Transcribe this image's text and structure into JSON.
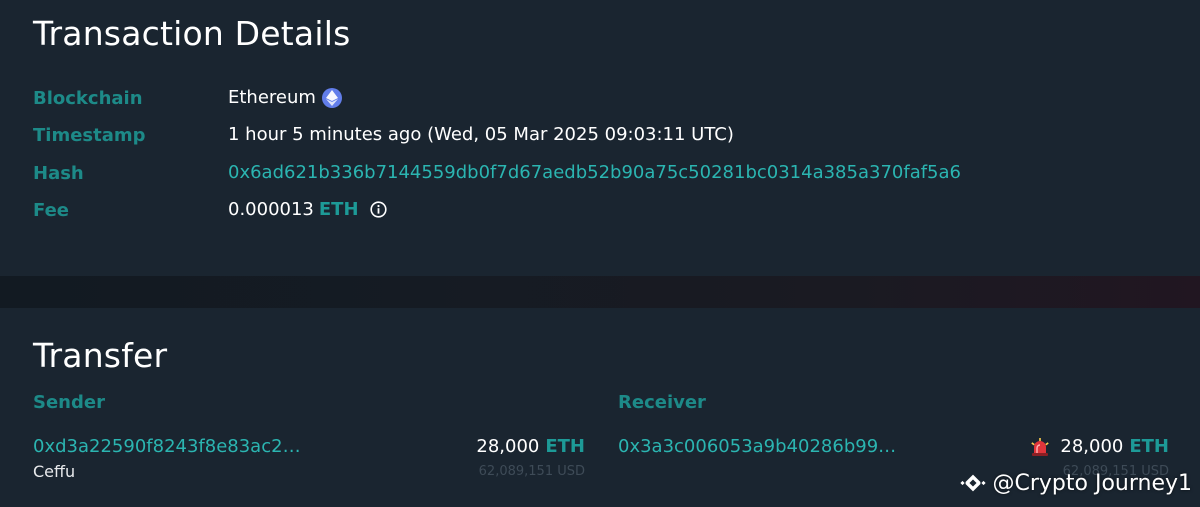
{
  "details": {
    "title": "Transaction Details",
    "rows": {
      "blockchain": {
        "label": "Blockchain",
        "value": "Ethereum",
        "icon": "ethereum-icon"
      },
      "timestamp": {
        "label": "Timestamp",
        "value": "1 hour 5 minutes ago (Wed, 05 Mar 2025 09:03:11 UTC)"
      },
      "hash": {
        "label": "Hash",
        "value": "0x6ad621b336b7144559db0f7d67aedb52b90a75c50281bc0314a385a370faf5a6"
      },
      "fee": {
        "label": "Fee",
        "amount": "0.000013",
        "unit": "ETH",
        "icon": "info-icon"
      }
    }
  },
  "transfer": {
    "title": "Transfer",
    "sender": {
      "label": "Sender",
      "address": "0xd3a22590f8243f8e83ac2…",
      "entity": "Ceffu",
      "amount": "28,000",
      "unit": "ETH",
      "usd": "62,089,151 USD"
    },
    "receiver": {
      "label": "Receiver",
      "address": "0x3a3c006053a9b40286b99…",
      "amount": "28,000",
      "unit": "ETH",
      "usd": "62,089,151 USD",
      "icon": "alarm-siren-icon"
    }
  },
  "watermark": {
    "text": "@Crypto Journey1",
    "icon": "binance-logo-icon"
  },
  "colors": {
    "background": "#1a2530",
    "label": "#1d8a88",
    "link": "#2bb5b1",
    "ethereum": "#627eea"
  }
}
